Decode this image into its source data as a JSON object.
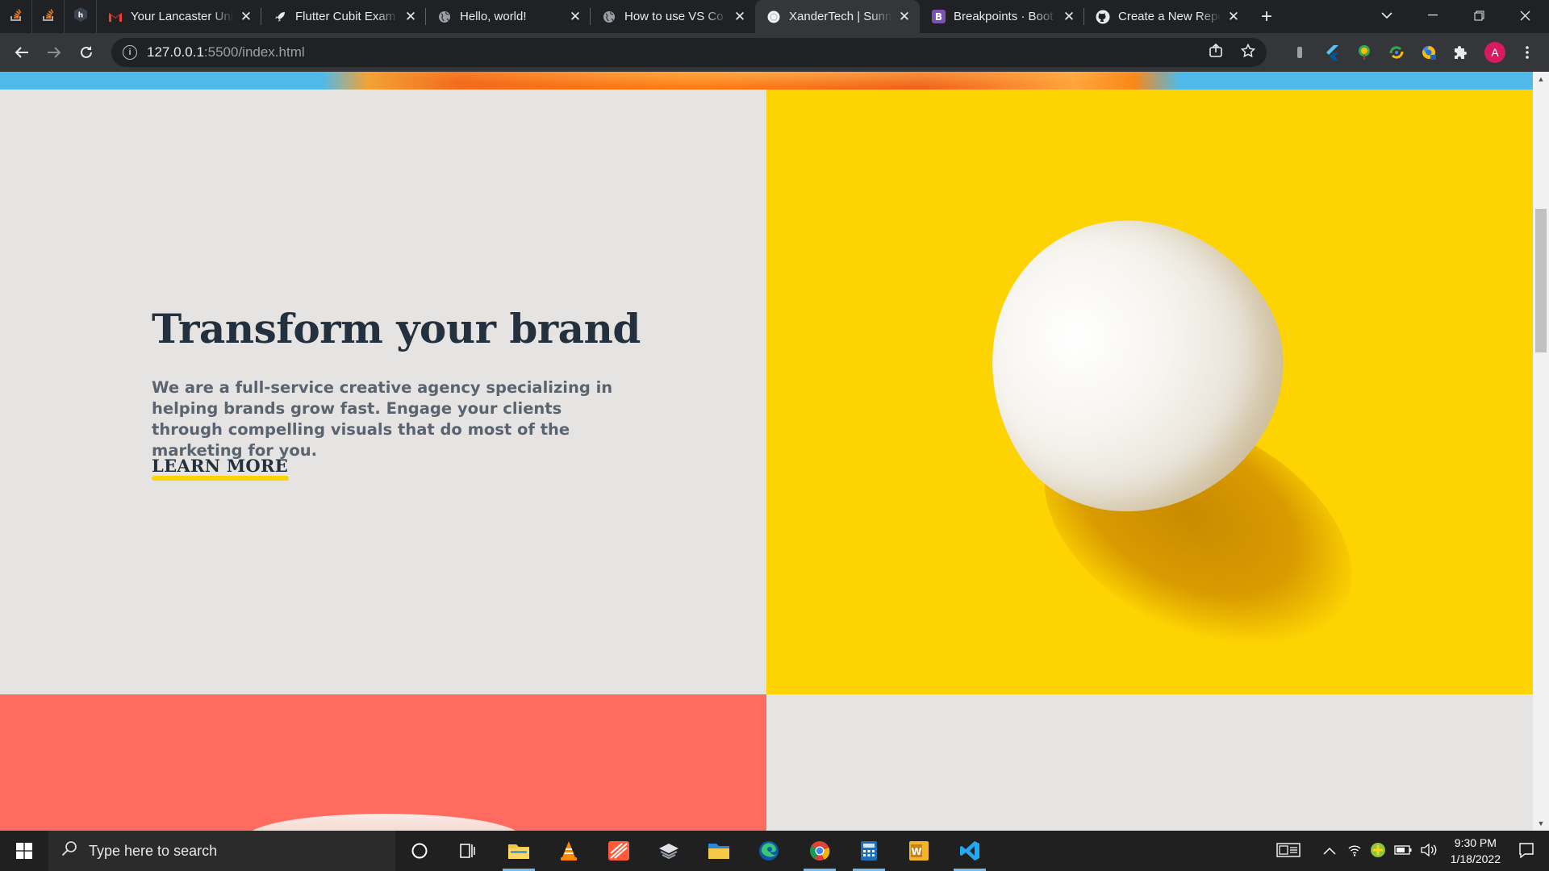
{
  "browser": {
    "pinned_tabs": [
      "stackoverflow-icon",
      "stackoverflow-icon",
      "hackerrank-icon"
    ],
    "tabs": [
      {
        "title": "Your Lancaster Uni",
        "icon": "gmail-icon",
        "active": false
      },
      {
        "title": "Flutter Cubit Exam",
        "icon": "rocket-icon",
        "active": false
      },
      {
        "title": "Hello, world!",
        "icon": "globe-icon",
        "active": false
      },
      {
        "title": "How to use VS Co",
        "icon": "globe-icon",
        "active": false
      },
      {
        "title": "XanderTech | Sunn",
        "icon": "page-icon",
        "active": true
      },
      {
        "title": "Breakpoints · Boot",
        "icon": "bootstrap-icon",
        "active": false
      },
      {
        "title": "Create a New Repo",
        "icon": "github-icon",
        "active": false
      }
    ],
    "new_tab_label": "+",
    "address": {
      "host": "127.0.0.1",
      "rest": ":5500/index.html"
    },
    "profile_initial": "A",
    "colors": {
      "tab_bar": "#202124",
      "toolbar": "#35363a",
      "profile": "#d81b60"
    }
  },
  "page": {
    "headline": "Transform your brand",
    "body": "We are a full-service creative agency specializing in helping brands grow fast. Engage your clients through compelling visuals that do most of the marketing for you.",
    "cta": "LEARN MORE",
    "colors": {
      "left_bg": "#e6e4e2",
      "right_bg": "#fdd402",
      "coral": "#ff6b5e",
      "heading": "#23303e",
      "text": "#5a6470",
      "cta_underline": "#fdd402"
    }
  },
  "taskbar": {
    "search_placeholder": "Type here to search",
    "time": "9:30 PM",
    "date": "1/18/2022",
    "apps": [
      "cortana-icon",
      "task-view-icon",
      "file-explorer-icon",
      "vlc-icon",
      "app-icon",
      "app-icon",
      "folder-icon",
      "edge-icon",
      "chrome-icon",
      "calculator-icon",
      "word-icon",
      "vscode-icon"
    ]
  }
}
